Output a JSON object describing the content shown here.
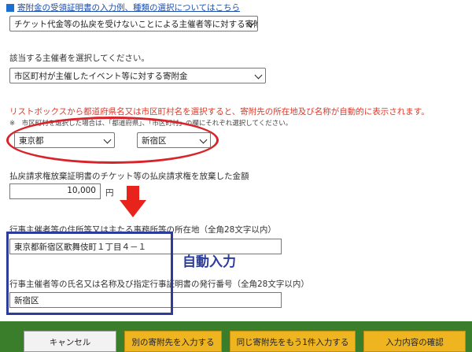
{
  "top_link": {
    "text": "寄附金の受領証明書の入力例、種類の選択についてはこちら"
  },
  "donation_type_select": {
    "value": "チケット代金等の払戻を受けないことによる主催者等に対する寄附金"
  },
  "organizer_prompt": "該当する主催者を選択してください。",
  "organizer_select": {
    "value": "市区町村が主催したイベント等に対する寄附金"
  },
  "red_note": "リストボックスから都道府県名又は市区町村名を選択すると、寄附先の所在地及び名称が自動的に表示されます。",
  "small_note": "※　市区町村を選択した場合は、「都道府県」、「市区町村」の欄にそれぞれ選択してください。",
  "prefecture_select": {
    "value": "東京都"
  },
  "city_select": {
    "value": "新宿区"
  },
  "amount_label": "払戻請求権放棄証明書のチケット等の払戻請求権を放棄した金額",
  "amount_input": {
    "value": "10,000",
    "unit": "円"
  },
  "address_label": "行事主催者等の住所等又は主たる事務所等の所在地（全角28文字以内）",
  "address_input": {
    "value": "東京都新宿区歌舞伎町１丁目４－１"
  },
  "name_label": "行事主催者等の氏名又は名称及び指定行事証明書の発行番号（全角28文字以内）",
  "name_input": {
    "value": "新宿区"
  },
  "annotation": {
    "auto_input": "自動入力"
  },
  "footer": {
    "cancel": "キャンセル",
    "add_other": "別の寄附先を入力する",
    "add_same": "同じ寄附先をもう1件入力する",
    "confirm": "入力内容の確認"
  },
  "colors": {
    "footer_bg": "#3a7d2a",
    "button_gold": "#efb520",
    "highlight_red": "#d8232a",
    "highlight_blue": "#2c3c9c"
  }
}
